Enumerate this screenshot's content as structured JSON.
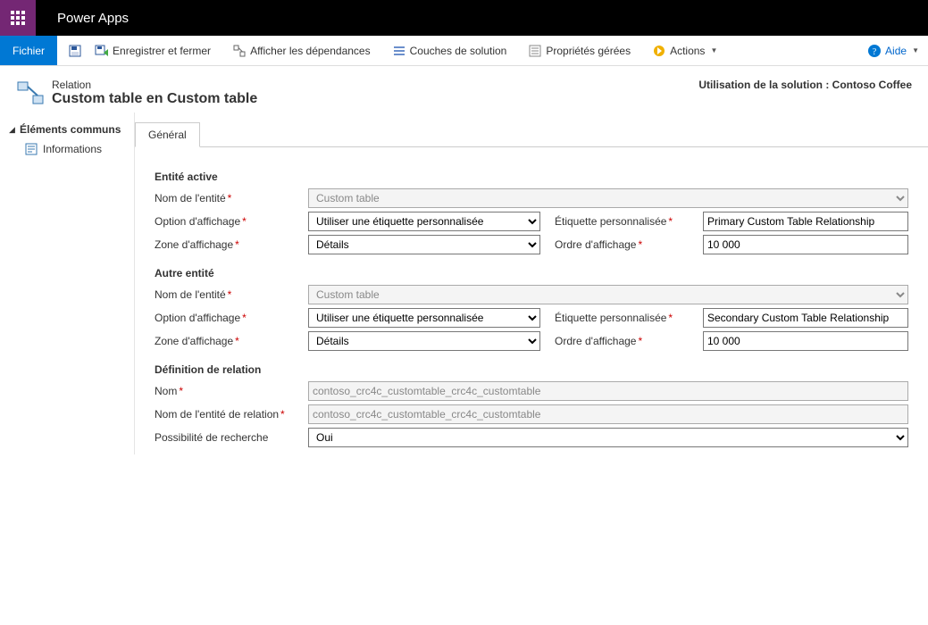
{
  "app": {
    "title": "Power Apps"
  },
  "commandbar": {
    "file": "Fichier",
    "save_close": "Enregistrer et fermer",
    "show_deps": "Afficher les dépendances",
    "solution_layers": "Couches de solution",
    "managed_props": "Propriétés gérées",
    "actions": "Actions",
    "help": "Aide"
  },
  "nav": {
    "group": "Éléments communs",
    "info": "Informations"
  },
  "header": {
    "super": "Relation",
    "title": "Custom table en Custom table",
    "solution_prefix": "Utilisation de la solution :",
    "solution_name": "Contoso Coffee"
  },
  "tabs": {
    "general": "Général"
  },
  "sections": {
    "active_entity": "Entité active",
    "other_entity": "Autre entité",
    "rel_def": "Définition de relation"
  },
  "labels": {
    "entity_name": "Nom de l'entité",
    "display_option": "Option d'affichage",
    "display_area": "Zone d'affichage",
    "custom_label": "Étiquette personnalisée",
    "display_order": "Ordre d'affichage",
    "name": "Nom",
    "rel_entity_name": "Nom de l'entité de relation",
    "searchable": "Possibilité de recherche"
  },
  "values": {
    "entity1": "Custom table",
    "disp_opt1": "Utiliser une étiquette personnalisée",
    "disp_area1": "Détails",
    "cust_label1": "Primary Custom Table Relationship",
    "order1": "10 000",
    "entity2": "Custom table",
    "disp_opt2": "Utiliser une étiquette personnalisée",
    "disp_area2": "Détails",
    "cust_label2": "Secondary Custom Table Relationship",
    "order2": "10 000",
    "rel_name": "contoso_crc4c_customtable_crc4c_customtable",
    "rel_entity": "contoso_crc4c_customtable_crc4c_customtable",
    "searchable": "Oui"
  }
}
